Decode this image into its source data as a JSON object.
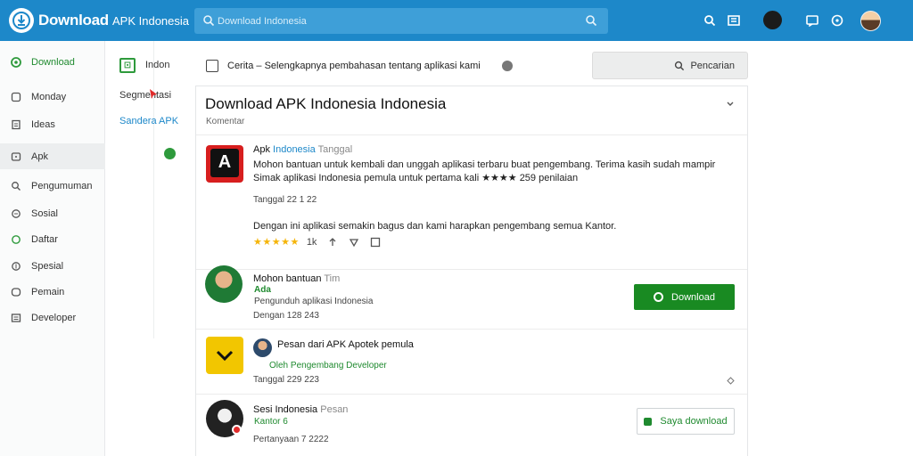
{
  "colors": {
    "topbar": "#1d88c9",
    "accent": "#1d88c9",
    "green": "#198a22",
    "star": "#f5b50a"
  },
  "header": {
    "brand": "Download",
    "brand_sub": "APK Indonesia",
    "search_placeholder": "Download Indonesia"
  },
  "sidebar": {
    "items": [
      {
        "label": "Download",
        "icon": "leaf-icon"
      },
      {
        "label": "Monday",
        "icon": "clock-icon"
      },
      {
        "label": "Ideas",
        "icon": "document-icon"
      },
      {
        "label": "Apk",
        "icon": "tag-icon"
      },
      {
        "label": "Pengumuman",
        "icon": "search-icon"
      },
      {
        "label": "Sosial",
        "icon": "heart-icon"
      },
      {
        "label": "Daftar",
        "icon": "refresh-icon"
      },
      {
        "label": "Spesial",
        "icon": "pin-icon"
      },
      {
        "label": "Pemain",
        "icon": "bookmark-icon"
      },
      {
        "label": "Developer",
        "icon": "grid-icon"
      }
    ]
  },
  "column2": {
    "title": "Indon",
    "item1": "Segmentasi",
    "item2": "Sandera APK"
  },
  "topline": {
    "breadcrumb": "Cerita – Selengkapnya pembahasan tentang aplikasi kami",
    "search_button": "Pencarian"
  },
  "card": {
    "title": "Download APK Indonesia Indonesia",
    "subtitle": "Komentar",
    "posts": [
      {
        "author": "Apk",
        "author_hl": "Indonesia",
        "author_muted": "Tanggal",
        "body1": "Mohon bantuan untuk kembali dan unggah aplikasi terbaru buat pengembang. Terima kasih sudah mampir",
        "body2": "Simak aplikasi Indonesia pemula untuk pertama kali ★★★★ 259 penilaian",
        "meta": "Tanggal 22 1 22",
        "reply": "Dengan ini aplikasi semakin bagus dan kami harapkan pengembang semua Kantor.",
        "rating_stars": "★★★★★",
        "rating_count": "1k"
      },
      {
        "author": "Mohon bantuan",
        "author_muted": "Tim",
        "line2": "Ada",
        "line3": "Pengunduh aplikasi Indonesia",
        "meta": "Dengan 128 243",
        "button": "Download"
      },
      {
        "author": "Pesan dari APK Apotek pemula",
        "line2": "Oleh Pengembang Developer",
        "meta": "Tanggal 229 223"
      },
      {
        "author": "Sesi Indonesia",
        "author_muted": "Pesan",
        "line2": "Kantor 6",
        "meta": "Pertanyaan 7 2222",
        "button": "Saya download"
      }
    ]
  }
}
